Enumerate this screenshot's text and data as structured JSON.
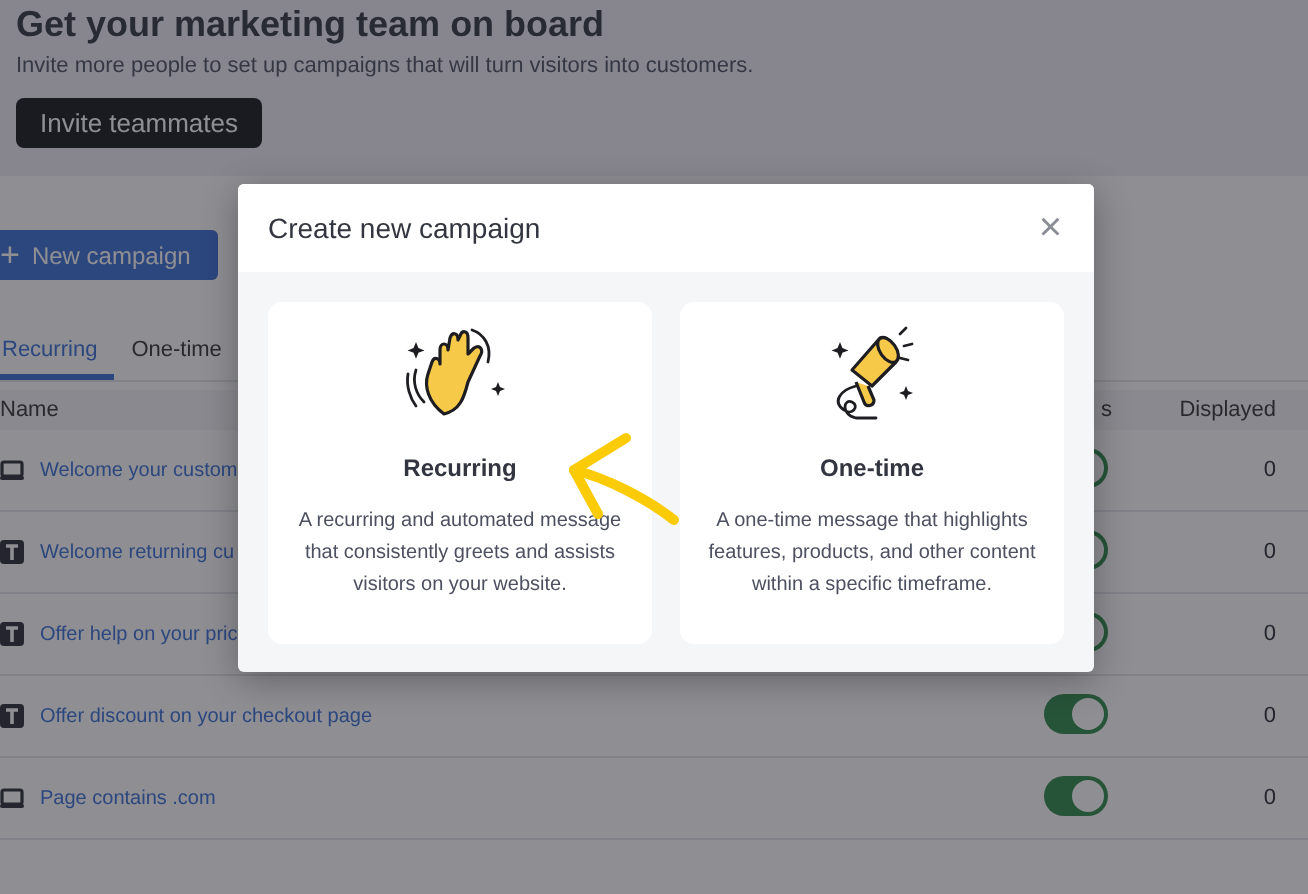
{
  "banner": {
    "title": "Get your marketing team on board",
    "subtitle": "Invite more people to set up campaigns that will turn visitors into customers.",
    "button": "Invite teammates"
  },
  "new_campaign_button": {
    "icon": "+",
    "label": "New campaign"
  },
  "tabs": [
    {
      "label": "Recurring",
      "selected": true
    },
    {
      "label": "One-time",
      "selected": false
    }
  ],
  "table": {
    "columns": [
      "Name",
      "s",
      "Displayed"
    ],
    "rows": [
      {
        "kind": "monitor",
        "name": "Welcome your custom",
        "on": true,
        "displayed": "0"
      },
      {
        "kind": "text",
        "name": "Welcome returning cu",
        "on": true,
        "displayed": "0"
      },
      {
        "kind": "text",
        "name": "Offer help on your pric",
        "on": true,
        "displayed": "0"
      },
      {
        "kind": "text",
        "name": "Offer discount on your checkout page",
        "on": true,
        "displayed": "0"
      },
      {
        "kind": "monitor",
        "name": "Page contains .com",
        "on": true,
        "displayed": "0"
      }
    ]
  },
  "modal": {
    "title": "Create new campaign",
    "close": "×",
    "options": [
      {
        "kind": "hand",
        "title": "Recurring",
        "description": "A recurring and automated message that consistently greets and assists visitors on your website."
      },
      {
        "kind": "megaphone",
        "title": "One-time",
        "description": "A one-time message that highlights features, products, and other content within a specific timeframe."
      }
    ]
  }
}
